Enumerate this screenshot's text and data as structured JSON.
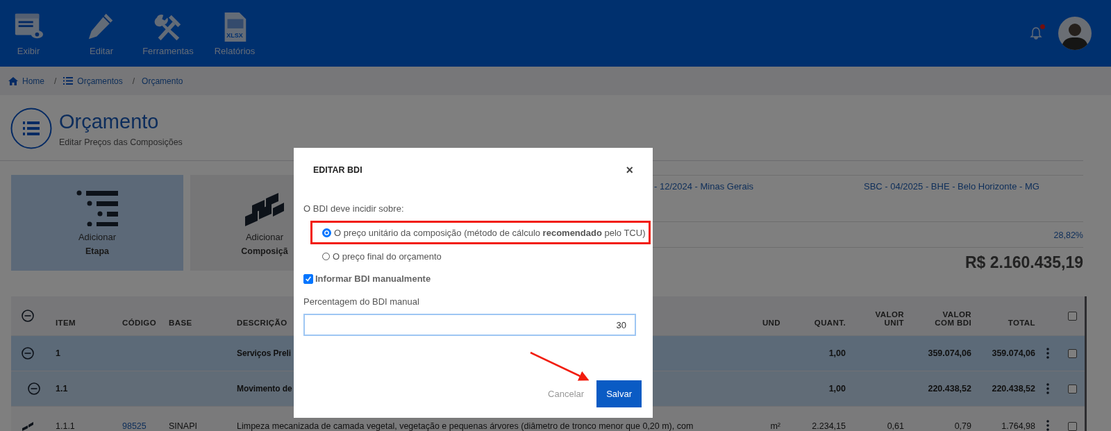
{
  "header": {
    "menu": [
      {
        "label": "Exibir"
      },
      {
        "label": "Editar"
      },
      {
        "label": "Ferramentas"
      },
      {
        "label": "Relatórios",
        "icon_text": "XLSX"
      }
    ],
    "notifications": {
      "unread": true
    }
  },
  "breadcrumbs": [
    {
      "label": "Home"
    },
    {
      "label": "Orçamentos",
      "separator": "/"
    },
    {
      "label": "Orçamento",
      "separator": "/"
    }
  ],
  "page": {
    "title": "Orçamento",
    "subtitle": "Editar Preços das Composições"
  },
  "cards": [
    {
      "line1": "Adicionar",
      "line2": "Etapa",
      "kind": "stage",
      "selected": true
    },
    {
      "line1": "Adicionar",
      "line2": "Composiçã",
      "kind": "composition",
      "selected": false
    }
  ],
  "info": {
    "region": "- 12/2024 - Minas Gerais",
    "reference": "SBC - 04/2025 - BHE - Belo Horizonte - MG",
    "bdi": "28,82%",
    "total": "R$ 2.160.435,19"
  },
  "table": {
    "columns": [
      "ITEM",
      "CÓDIGO",
      "BASE",
      "DESCRIÇÃO",
      "UND",
      "QUANT.",
      "VALOR UNIT",
      "VALOR COM BDI",
      "TOTAL"
    ],
    "all_checked": false,
    "rows": [
      {
        "kind": "stage",
        "expanded": true,
        "selected": false,
        "item": "1",
        "description": "Serviços Preli",
        "quantity": "1,00",
        "value_bdi": "359.074,06",
        "total": "359.074,06"
      },
      {
        "kind": "substage",
        "expanded": true,
        "selected": false,
        "item": "1.1",
        "description": "Movimento de",
        "quantity": "1,00",
        "value_bdi": "220.438,52",
        "total": "220.438,52"
      },
      {
        "kind": "composition",
        "selected": false,
        "item": "1.1.1",
        "code": "98525",
        "base": "SINAPI",
        "description": "Limpeza mecanizada de camada vegetal, vegetação e pequenas árvores (diâmetro de tronco menor que 0,20 m), com",
        "unit": "m²",
        "quantity": "2.234,15",
        "value_unit": "0,61",
        "value_bdi": "0,79",
        "total": "1.764,98"
      }
    ]
  },
  "modal": {
    "title": "EDITAR BDI",
    "close": "×",
    "question": "O BDI deve incidir sobre:",
    "options": [
      {
        "label": "O preço unitário da composição (método de cálculo **recomendado** pelo TCU)",
        "selected": true,
        "highlighted": true
      },
      {
        "label": "O preço final do orçamento",
        "selected": false,
        "highlighted": false
      }
    ],
    "manual": {
      "label": "Informar BDI manualmente",
      "checked": true
    },
    "field": {
      "label": "Percentagem do BDI manual",
      "value": "30"
    },
    "buttons": [
      {
        "label": "Cancelar",
        "kind": "secondary"
      },
      {
        "label": "Salvar",
        "kind": "primary"
      }
    ]
  }
}
